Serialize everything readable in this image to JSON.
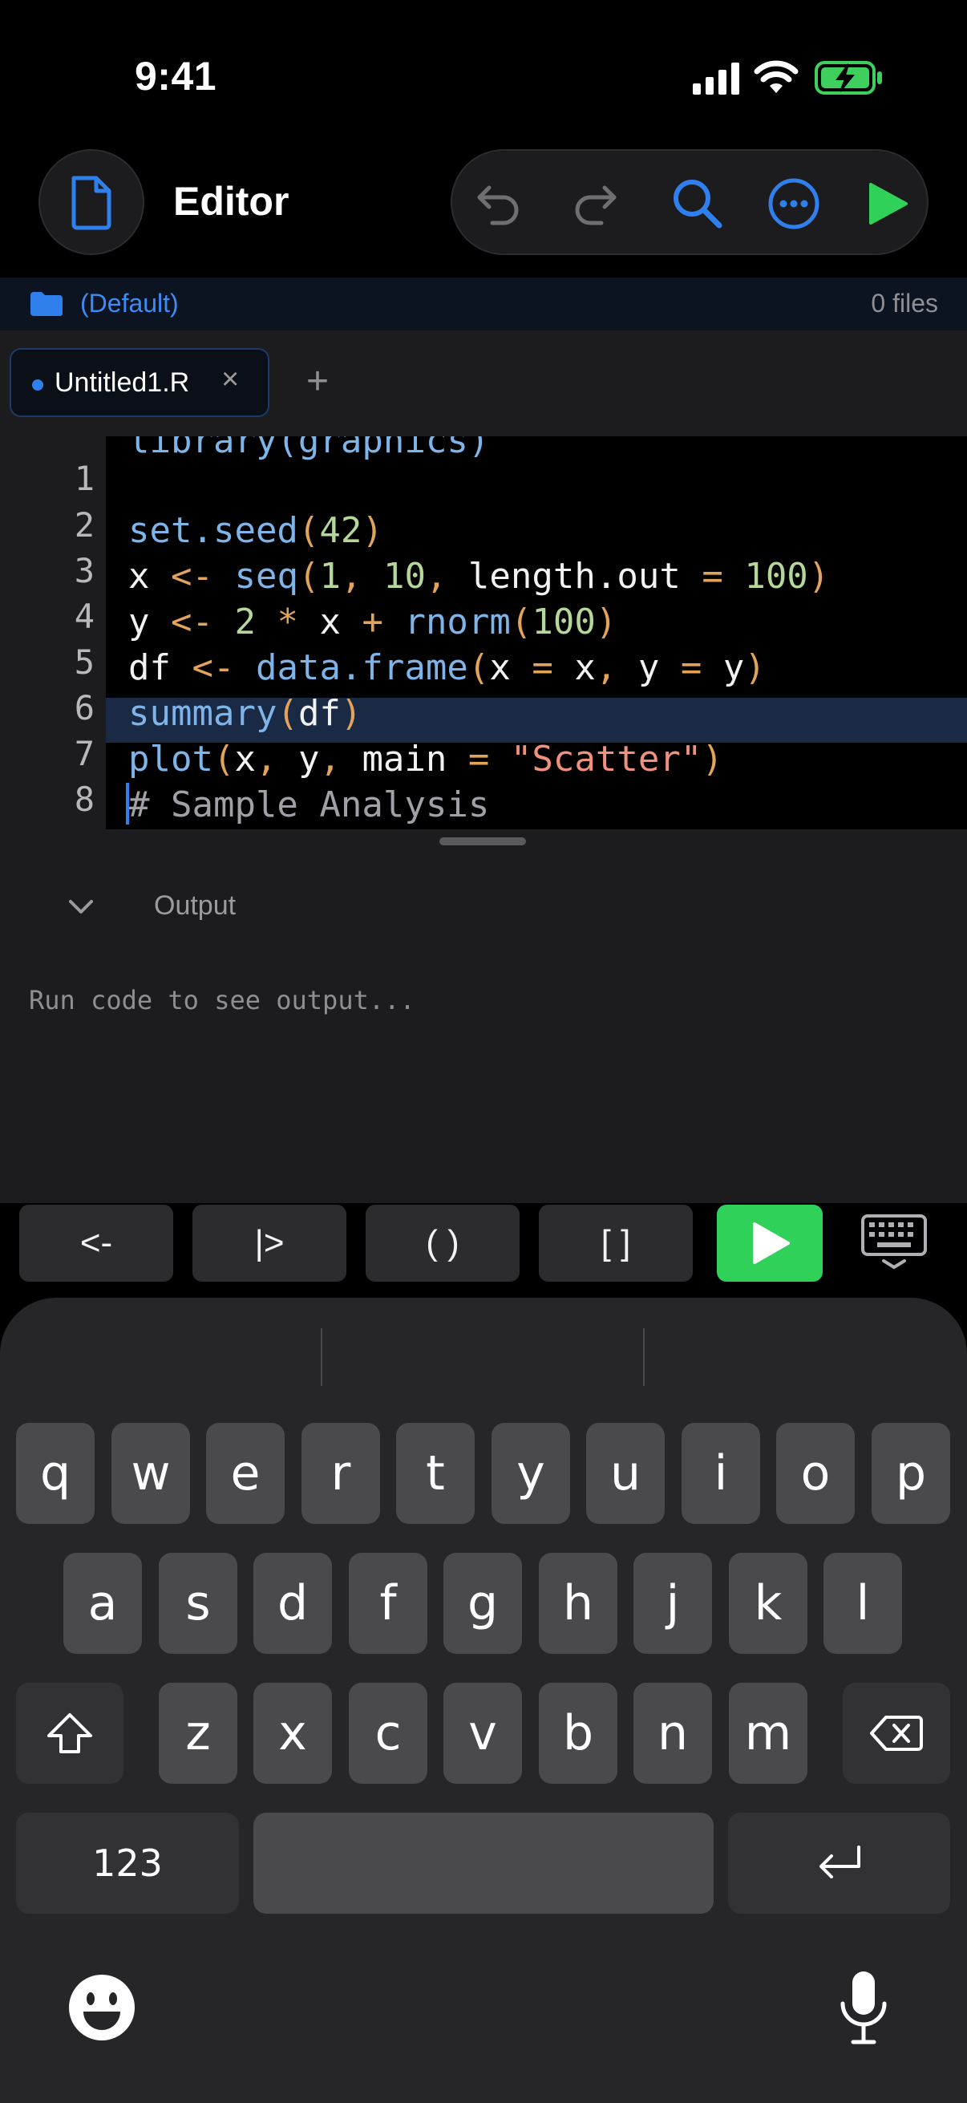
{
  "status_bar": {
    "time": "9:41"
  },
  "toolbar": {
    "title": "Editor"
  },
  "project": {
    "name": "(Default)",
    "file_count": "0 files"
  },
  "tabs": [
    {
      "label": "Untitled1.R",
      "close": "×"
    }
  ],
  "tab_add": "+",
  "editor": {
    "partial_line": "library(graphics)",
    "line_numbers": [
      "1",
      "2",
      "3",
      "4",
      "5",
      "6",
      "7",
      "8"
    ]
  },
  "output": {
    "title": "Output",
    "placeholder": "Run code to see output..."
  },
  "snippets": [
    "<-",
    "|>",
    "( )",
    "[ ]"
  ],
  "keyboard": {
    "row1": [
      "q",
      "w",
      "e",
      "r",
      "t",
      "y",
      "u",
      "i",
      "o",
      "p"
    ],
    "row2": [
      "a",
      "s",
      "d",
      "f",
      "g",
      "h",
      "j",
      "k",
      "l"
    ],
    "row3": [
      "z",
      "x",
      "c",
      "v",
      "b",
      "n",
      "m"
    ],
    "numbers_key": "123"
  },
  "colors": {
    "accent": "#2f80ed",
    "run_green": "#30d158",
    "background": "#000000"
  }
}
